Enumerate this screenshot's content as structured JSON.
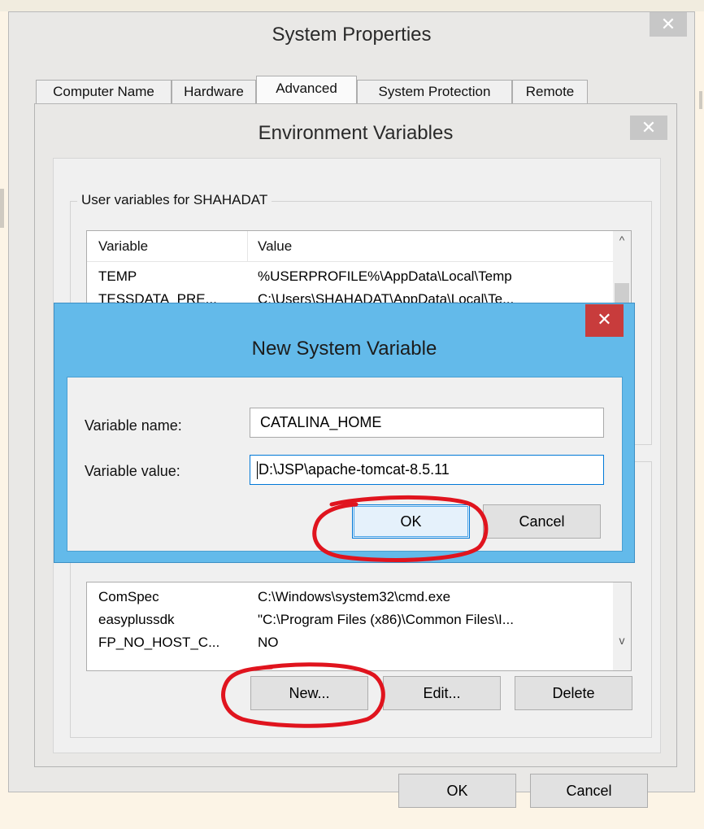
{
  "system_properties": {
    "title": "System Properties",
    "close_glyph": "✕",
    "tabs": [
      {
        "label": "Computer Name"
      },
      {
        "label": "Hardware"
      },
      {
        "label": "Advanced"
      },
      {
        "label": "System Protection"
      },
      {
        "label": "Remote"
      }
    ],
    "active_tab": "Advanced"
  },
  "environment_variables": {
    "title": "Environment Variables",
    "close_glyph": "✕",
    "user_group_label": "User variables for SHAHADAT",
    "user_columns": {
      "variable": "Variable",
      "value": "Value"
    },
    "user_rows": [
      {
        "variable": "TEMP",
        "value": "%USERPROFILE%\\AppData\\Local\\Temp"
      },
      {
        "variable": "TESSDATA_PRE...",
        "value": "C:\\Users\\SHAHADAT\\AppData\\Local\\Te..."
      }
    ],
    "system_rows": [
      {
        "variable": "ComSpec",
        "value": "C:\\Windows\\system32\\cmd.exe"
      },
      {
        "variable": "easyplussdk",
        "value": "\"C:\\Program Files (x86)\\Common Files\\I..."
      },
      {
        "variable": "FP_NO_HOST_C...",
        "value": "NO"
      }
    ],
    "scroll_up_glyph": "^",
    "scroll_down_glyph": "v",
    "buttons": {
      "new": "New...",
      "edit": "Edit...",
      "delete": "Delete"
    },
    "ok": "OK",
    "cancel": "Cancel"
  },
  "new_system_variable": {
    "title": "New System Variable",
    "close_glyph": "✕",
    "name_label": "Variable name:",
    "name_value": "CATALINA_HOME",
    "value_label": "Variable value:",
    "value_value": "D:\\JSP\\apache-tomcat-8.5.11",
    "ok": "OK",
    "cancel": "Cancel"
  },
  "annotations": {
    "color": "#e0141e",
    "circled": [
      "OK",
      "New..."
    ]
  },
  "colors": {
    "dialog_blue": "#63baea",
    "close_red": "#c83c3c",
    "window_face": "#f0f0f0",
    "accent_focus": "#0078d7"
  }
}
